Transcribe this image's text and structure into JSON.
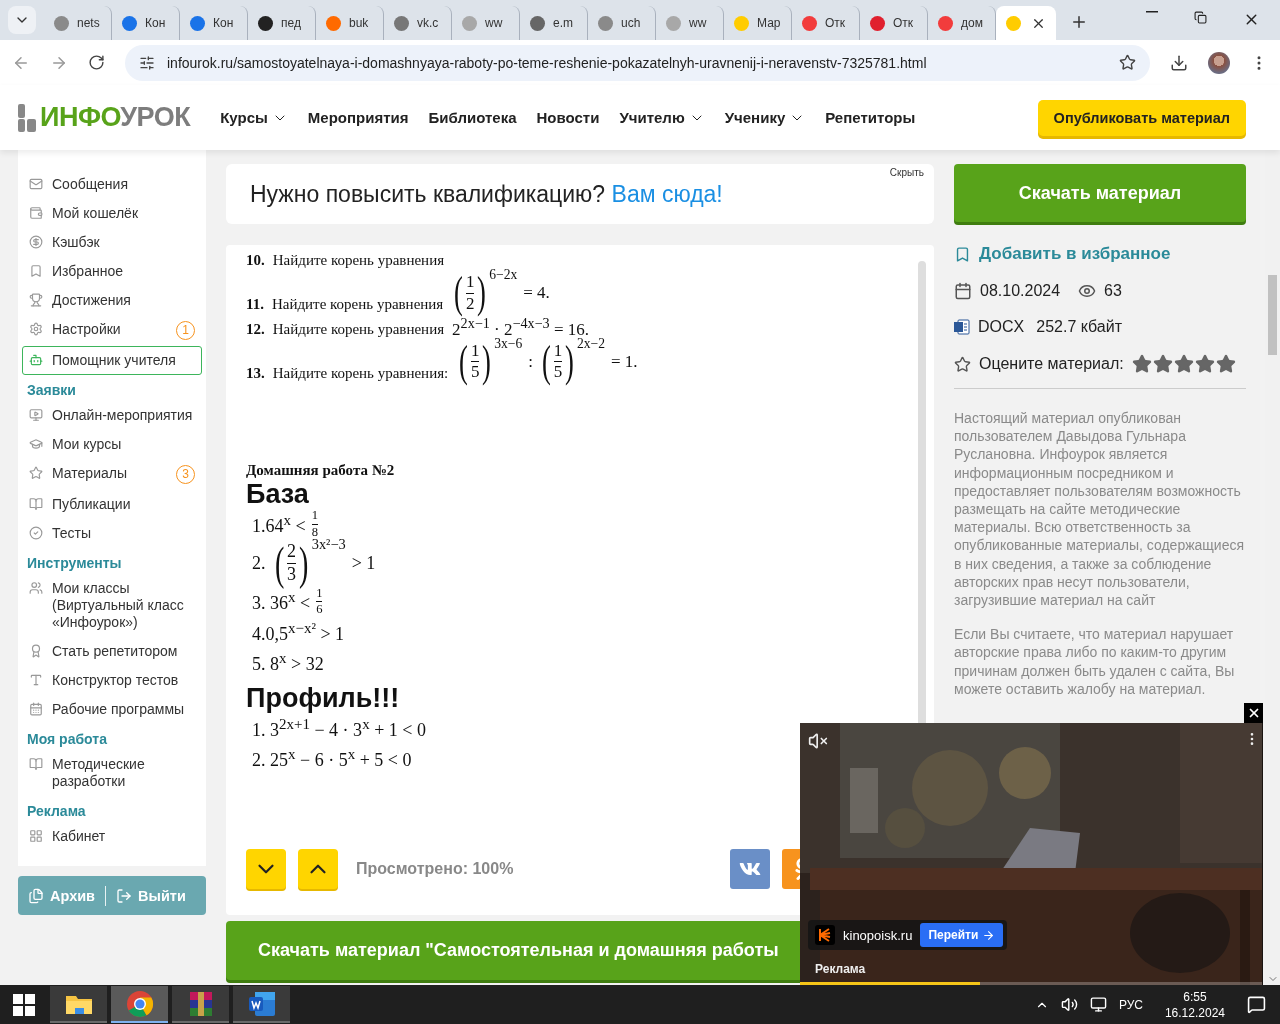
{
  "browser": {
    "tabs": [
      {
        "title": "nets",
        "color": "#8a8a8a",
        "selected": false
      },
      {
        "title": "Кон",
        "color": "#1a73e8",
        "selected": false
      },
      {
        "title": "Кон",
        "color": "#1a73e8",
        "selected": false
      },
      {
        "title": "пед",
        "color": "#222222",
        "selected": false
      },
      {
        "title": "buk",
        "color": "#ff6a00",
        "selected": false
      },
      {
        "title": "vk.c",
        "color": "#777777",
        "selected": false
      },
      {
        "title": "ww",
        "color": "#a8a8a8",
        "selected": false
      },
      {
        "title": "e.m",
        "color": "#666666",
        "selected": false
      },
      {
        "title": "uch",
        "color": "#8a8a8a",
        "selected": false
      },
      {
        "title": "ww",
        "color": "#a8a8a8",
        "selected": false
      },
      {
        "title": "Мар",
        "color": "#ffcc00",
        "selected": false
      },
      {
        "title": "Отк",
        "color": "#f23c3c",
        "selected": false
      },
      {
        "title": "Отк",
        "color": "#e0202e",
        "selected": false
      },
      {
        "title": "дом",
        "color": "#f23c3c",
        "selected": false
      },
      {
        "color": "#ffcc00",
        "selected": true
      }
    ],
    "url": "infourok.ru/samostoyatelnaya-i-domashnyaya-raboty-po-teme-reshenie-pokazatelnyh-uravnenij-i-neravenstv-7325781.html"
  },
  "header": {
    "logo": [
      "ИНФО",
      "УРОК"
    ],
    "nav": [
      {
        "label": "Курсы",
        "dropdown": true
      },
      {
        "label": "Мероприятия",
        "dropdown": false
      },
      {
        "label": "Библиотека",
        "dropdown": false
      },
      {
        "label": "Новости",
        "dropdown": false
      },
      {
        "label": "Учителю",
        "dropdown": true
      },
      {
        "label": "Ученику",
        "dropdown": true
      },
      {
        "label": "Репетиторы",
        "dropdown": false
      }
    ],
    "publish": "Опубликовать материал"
  },
  "sidebar": {
    "groups": [
      {
        "items": [
          {
            "label": "Сообщения",
            "kind": "item"
          },
          {
            "label": "Мой кошелёк",
            "kind": "item"
          },
          {
            "label": "Кэшбэк",
            "kind": "item"
          },
          {
            "label": "Избранное",
            "kind": "item"
          },
          {
            "label": "Достижения",
            "kind": "item"
          },
          {
            "label": "Настройки",
            "kind": "item",
            "badge": "1"
          },
          {
            "label": "Помощник учителя",
            "kind": "outlined"
          }
        ]
      },
      {
        "title": "Заявки",
        "items": [
          {
            "label": "Онлайн-мероприятия",
            "kind": "item"
          },
          {
            "label": "Мои курсы",
            "kind": "item"
          },
          {
            "label": "Материалы",
            "kind": "item",
            "badge": "3"
          },
          {
            "label": "Публикации",
            "kind": "item"
          },
          {
            "label": "Тесты",
            "kind": "item"
          }
        ]
      },
      {
        "title": "Инструменты",
        "items": [
          {
            "label": "Мои классы (Виртуальный класс «Инфоурок»)",
            "kind": "item"
          },
          {
            "label": "Стать репетитором",
            "kind": "item"
          },
          {
            "label": "Конструктор тестов",
            "kind": "item"
          },
          {
            "label": "Рабочие программы",
            "kind": "item"
          }
        ]
      },
      {
        "title": "Моя работа",
        "items": [
          {
            "label": "Методические разработки",
            "kind": "item"
          }
        ]
      },
      {
        "title": "Реклама",
        "items": [
          {
            "label": "Кабинет",
            "kind": "item"
          }
        ]
      }
    ],
    "archive": "Архив",
    "logout": "Выйти"
  },
  "banner": {
    "text": "Нужно повысить квалификацию? ",
    "link": "Вам сюда!",
    "hide": "Скрыть"
  },
  "document": {
    "problems": [
      {
        "number": "10.",
        "text": "Найдите корень уравнения"
      },
      {
        "number": "11.",
        "text": "Найдите корень уравнения",
        "parts": [
          {
            "kind": "frac",
            "open": "(",
            "num": "1",
            "den": "2",
            "close": ")",
            "exp": "6−2x"
          },
          {
            "kind": "text",
            "text": "= 4."
          }
        ]
      },
      {
        "number": "12.",
        "text": "Найдите корень уравнения",
        "parts": [
          {
            "kind": "text",
            "text": "2$^{2x−1}$ · 2$^{−4x−3}$ = 16."
          }
        ]
      },
      {
        "number": "13.",
        "text": "Найдите корень уравнения:",
        "parts": [
          {
            "kind": "frac",
            "open": "(",
            "num": "1",
            "den": "5",
            "close": ")",
            "exp": "3x−6"
          },
          {
            "kind": "text",
            "text": ":"
          },
          {
            "kind": "frac",
            "open": "(",
            "num": "1",
            "den": "5",
            "close": ")",
            "exp": "2x−2"
          },
          {
            "kind": "text",
            "text": "= 1."
          }
        ]
      }
    ],
    "homework": "Домашняя работа №2",
    "sections": [
      {
        "heading": "База",
        "items": [
          {
            "parts": [
              {
                "kind": "text",
                "text": "1.64$^{x}$ <"
              },
              {
                "kind": "frac",
                "num": "1",
                "den": "8"
              }
            ]
          },
          {
            "parts": [
              {
                "kind": "text",
                "text": "2."
              },
              {
                "kind": "frac",
                "open": "(",
                "num": "2",
                "den": "3",
                "close": ")",
                "exp": "3x²−3"
              },
              {
                "kind": "text",
                "text": "> 1"
              }
            ]
          },
          {
            "parts": [
              {
                "kind": "text",
                "text": "3. 36$^{x}$ <"
              },
              {
                "kind": "frac",
                "num": "1",
                "den": "6"
              }
            ]
          },
          {
            "parts": [
              {
                "kind": "text",
                "text": "4.0,5$^{x−x²}$ > 1"
              }
            ]
          },
          {
            "parts": [
              {
                "kind": "text",
                "text": "5. 8$^{x}$ > 32"
              }
            ]
          }
        ]
      },
      {
        "heading": "Профиль!!!",
        "items": [
          {
            "parts": [
              {
                "kind": "text",
                "text": "1. 3$^{2x+1}$ − 4 · 3$^{x}$ + 1 < 0"
              }
            ]
          },
          {
            "parts": [
              {
                "kind": "text",
                "text": "2. 25$^{x}$ − 6 · 5$^{x}$ + 5 < 0"
              }
            ]
          }
        ]
      }
    ],
    "viewed": "Просмотрено: 100%"
  },
  "download_all": "Скачать материал \"Самостоятельная и домашняя работы",
  "details": {
    "download": "Скачать материал",
    "favorite": "Добавить в избранное",
    "date": "08.10.2024",
    "views": "63",
    "format": "DOCX",
    "size": "252.7 кбайт",
    "rate": "Оцените материал:",
    "notes": [
      "Настоящий материал опубликован пользователем Давыдова Гульнара Руслановна. Инфоурок является информационным посредником и предоставляет пользователям возможность размещать на сайте методические материалы. Всю ответственность за опубликованные материалы, содержащиеся в них сведения, а также за соблюдение авторских прав несут пользователи, загрузившие материал на сайт",
      "Если Вы считаете, что материал нарушает авторские права либо по каким-то другим причинам должен быть удален с сайта, Вы можете оставить жалобу на материал."
    ]
  },
  "ad": {
    "site": "kinopoisk.ru",
    "cta": "Перейти",
    "label": "Реклама",
    "level": 0.39
  },
  "taskbar": {
    "apps": [
      {
        "kind": "explorer",
        "selected": false
      },
      {
        "kind": "chrome",
        "selected": true
      },
      {
        "kind": "winrar",
        "selected": false
      },
      {
        "kind": "word",
        "selected": false
      }
    ],
    "language": "РУС",
    "time": "6:55",
    "date": "16.12.2024"
  }
}
